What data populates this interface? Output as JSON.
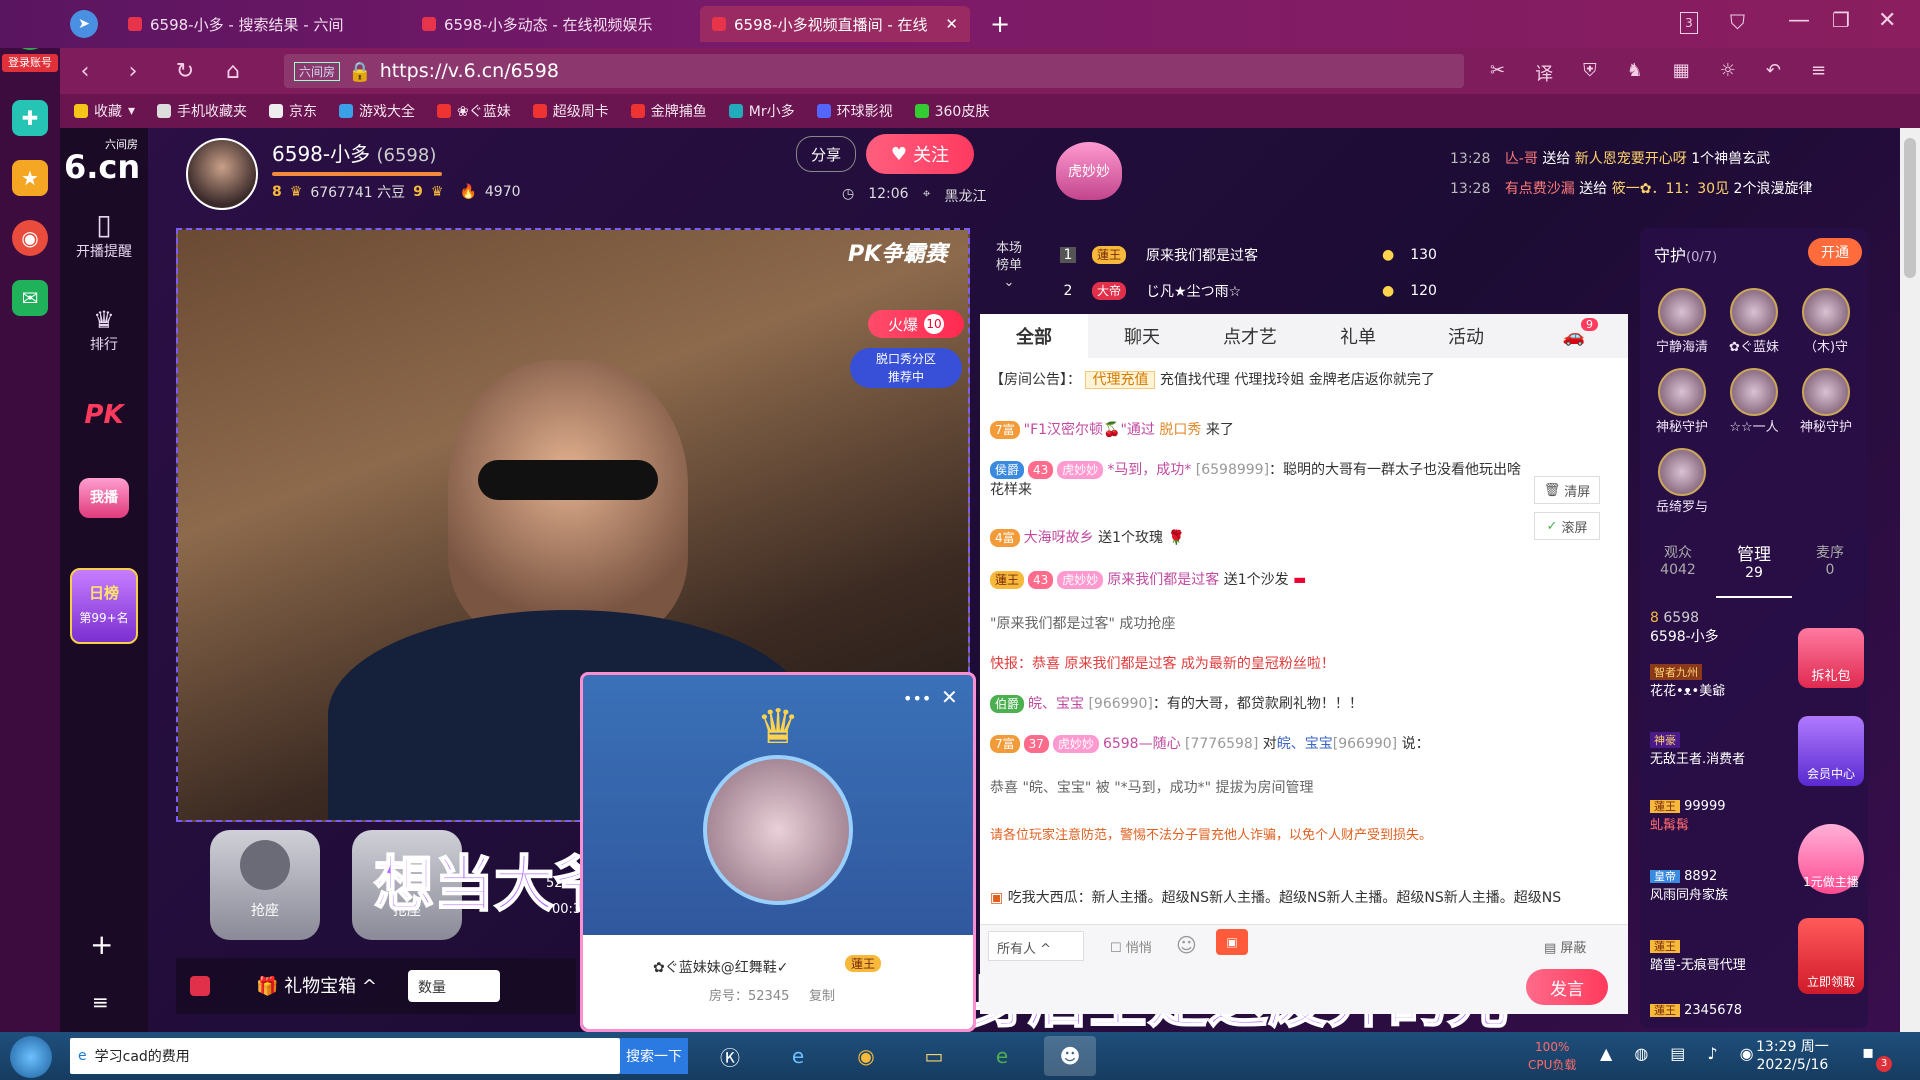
{
  "browser": {
    "tabs": [
      {
        "label": "6598-小多 - 搜索结果 - 六间"
      },
      {
        "label": "6598-小多动态 - 在线视频娱乐"
      },
      {
        "label": "6598-小多视频直播间 - 在线"
      }
    ],
    "badge_count": "3",
    "url": "https://v.6.cn/6598",
    "url_tag": "六间房",
    "login_label": "登录账号",
    "bookmarks": [
      "收藏",
      "手机收藏夹",
      "京东",
      "游戏大全",
      "❀ぐ蓝妹",
      "超级周卡",
      "金牌捕鱼",
      "Mr小多",
      "环球影视",
      "360皮肤"
    ]
  },
  "site_nav": {
    "logo_top": "六间房",
    "logo": "6.cn",
    "items": [
      "开播提醒",
      "排行",
      "PK",
      "我播"
    ],
    "daily_rank_title": "日榜",
    "daily_rank_value": "第99+名",
    "add": "+",
    "menu": "≡"
  },
  "streamer": {
    "name": "6598-小多",
    "room_id": "(6598)",
    "level_left": "8",
    "beans": "6767741 六豆",
    "level_right": "9",
    "fans": "4970",
    "time": "12:06",
    "location": "黑龙江",
    "share_label": "分享",
    "follow_label": "关注",
    "badge_name": "虎妙妙"
  },
  "broadcasts": [
    {
      "time": "13:28",
      "user": "亾-哥",
      "action": "送给",
      "target": "新人恩宠要开心呀",
      "gift": "1个神兽玄武"
    },
    {
      "time": "13:28",
      "user": "有点费沙漏",
      "action": "送给",
      "target": "筱一✿．11：30见",
      "gift": "2个浪漫旋律"
    }
  ],
  "video": {
    "corner_brand": "PK争霸赛",
    "fire_label": "火爆",
    "fire_level": "10",
    "recommend_line1": "脱口秀分区",
    "recommend_line2": "推荐中",
    "seat_label_1": "抢座",
    "seat_label_2": "抢座",
    "overlay_text_1": "想当大爷就跪地下当",
    "overlay_text_2": "身后全是这废弃的光",
    "side_num": "529",
    "side_time": "00:3"
  },
  "bottom_bar": {
    "gift_box": "礼物宝箱",
    "quantity": "数量"
  },
  "popup": {
    "more": "•••",
    "close": "✕",
    "name": "✿ぐ蓝妹妹@红舞鞋✓",
    "badge": "蓮王",
    "room": "房号：52345",
    "copy": "复制"
  },
  "rank": {
    "title_line1": "本场",
    "title_line2": "榜单",
    "rows": [
      {
        "pos": "1",
        "badge": "蓮王",
        "name": "原来我们都是过客",
        "score": "130"
      },
      {
        "pos": "2",
        "badge": "大帝",
        "name": "じ凡★尘つ雨☆",
        "score": "120"
      }
    ]
  },
  "chat_tabs": [
    "全部",
    "聊天",
    "点才艺",
    "礼单",
    "活动"
  ],
  "chat_tab_badge": "9",
  "announcement": {
    "label": "【房间公告】：",
    "tag": "代理充值",
    "text": "充值找代理 代理找玲姐 金牌老店返你就完了"
  },
  "messages": [
    {
      "badge": "7富",
      "text1": "\"F1汉密尔顿🍒\"通过 ",
      "link": "脱口秀",
      "text2": " 来了"
    },
    {
      "badge": "侯爵",
      "level": "43",
      "tag": "虎妙妙",
      "user": "*马到，成功*",
      "uid": "[6598999]",
      "text": "：聪明的大哥有一群太子也没看他玩出啥花样来"
    },
    {
      "badge": "4富",
      "user": "大海呀故乡",
      "text": "送1个玫瑰"
    },
    {
      "badge": "蓮王",
      "level": "43",
      "tag": "虎妙妙",
      "user": "原来我们都是过客",
      "text": "送1个沙发"
    },
    {
      "text": "\"原来我们都是过客\" 成功抢座"
    },
    {
      "prefix": "快报：恭喜",
      "user": "原来我们都是过客",
      "text": "成为最新的皇冠粉丝啦！"
    },
    {
      "badge": "伯爵",
      "user": "皖、宝宝",
      "uid": "[966990]",
      "text": "：有的大哥，都贷款刷礼物！！！"
    },
    {
      "badge": "7富",
      "level": "37",
      "tag": "虎妙妙",
      "user": "6598—随心",
      "uid": "[7776598]",
      "mid": "对",
      "user2": "皖、宝宝",
      "uid2": "[966990]",
      "text": "说："
    },
    {
      "text": "恭喜 \"皖、宝宝\" 被 \"*马到，成功*\" 提拔为房间管理"
    }
  ],
  "chat_tools": {
    "clear": "清屏",
    "scroll": "滚屏"
  },
  "warning": "请各位玩家注意防范，警惕不法分子冒充他人诈骗，以免个人财产受到损失。",
  "system_ticker": {
    "user": "吃我大西瓜",
    "text": "：新人主播。超级NS新人主播。超级NS新人主播。超级NS新人主播。超级NS"
  },
  "input": {
    "target": "所有人",
    "whisper": "悄悄",
    "block": "屏蔽",
    "send": "发言"
  },
  "guard": {
    "title": "守护",
    "count": "(0/7)",
    "open": "开通",
    "members": [
      "宁静海清",
      "✿ぐ蓝妹",
      "（木)守",
      "神秘守护",
      "☆☆一人",
      "神秘守护",
      "岳绮罗与"
    ],
    "tabs": [
      {
        "label": "观众",
        "value": "4042"
      },
      {
        "label": "管理",
        "value": "29"
      },
      {
        "label": "麦序",
        "value": "0"
      }
    ]
  },
  "audience": [
    {
      "level": "8",
      "name": "6598",
      "sub": "6598-小多"
    },
    {
      "badge": "智者九州",
      "name": "花花•ᴥ•美爺"
    },
    {
      "badge": "神豪",
      "name": "无敌王者.消费者"
    },
    {
      "badge": "蓮王",
      "name": "99999",
      "sub": "虬髯髯"
    },
    {
      "badge": "皇帝",
      "name": "8892",
      "sub": "风雨同舟家族"
    },
    {
      "badge": "蓮王",
      "name": "踏雪-无痕哥代理"
    },
    {
      "badge": "蓮王",
      "name": "2345678"
    }
  ],
  "promos": [
    "拆礼包",
    "会员中心",
    "1元做主播",
    "立即领取"
  ],
  "taskbar": {
    "search_item": "学习cad的费用",
    "search_btn": "搜索一下",
    "cpu_pct": "100%",
    "cpu_label": "CPU负载",
    "clock_time": "13:29 周一",
    "clock_date": "2022/5/16",
    "notif_count": "3"
  }
}
